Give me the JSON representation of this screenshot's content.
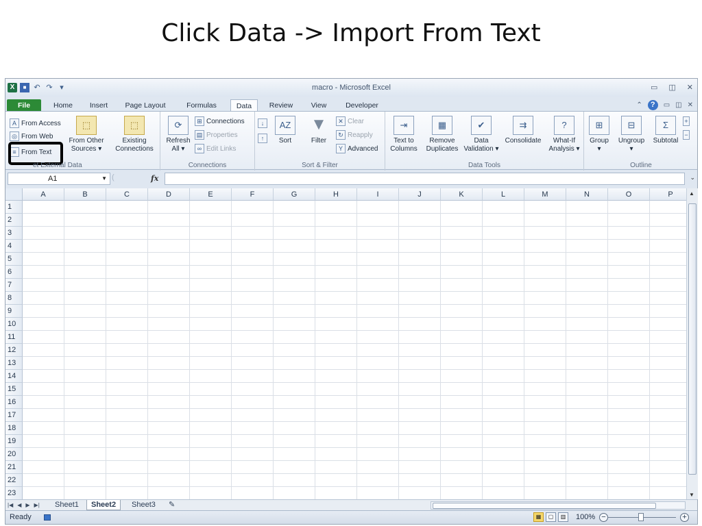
{
  "slide_title": "Click Data -> Import From Text",
  "window": {
    "title": "macro  -  Microsoft Excel",
    "qat_icons": [
      "excel-logo-icon",
      "save-icon",
      "undo-icon",
      "redo-icon",
      "customize-qat-icon"
    ]
  },
  "tabs": {
    "file": "File",
    "home": "Home",
    "insert": "Insert",
    "page_layout": "Page Layout",
    "formulas": "Formulas",
    "data": "Data",
    "review": "Review",
    "view": "View",
    "developer": "Developer"
  },
  "ribbon": {
    "get_external": {
      "from_access": "From Access",
      "from_web": "From Web",
      "from_text": "From Text",
      "from_other_1": "From Other",
      "from_other_2": "Sources ▾",
      "existing_1": "Existing",
      "existing_2": "Connections",
      "label": "Get External Data",
      "label_visible": "et External Data"
    },
    "connections": {
      "refresh_1": "Refresh",
      "refresh_2": "All ▾",
      "connections": "Connections",
      "properties": "Properties",
      "edit_links": "Edit Links",
      "label": "Connections"
    },
    "sort_filter": {
      "sort": "Sort",
      "filter": "Filter",
      "clear": "Clear",
      "reapply": "Reapply",
      "advanced": "Advanced",
      "label": "Sort & Filter"
    },
    "data_tools": {
      "text_to_1": "Text to",
      "text_to_2": "Columns",
      "remove_1": "Remove",
      "remove_2": "Duplicates",
      "validation_1": "Data",
      "validation_2": "Validation ▾",
      "consolidate": "Consolidate",
      "whatif_1": "What-If",
      "whatif_2": "Analysis ▾",
      "label": "Data Tools"
    },
    "outline": {
      "group": "Group",
      "ungroup": "Ungroup",
      "subtotal": "Subtotal",
      "label": "Outline"
    }
  },
  "formula_bar": {
    "name_box": "A1",
    "fx": "fx",
    "value": ""
  },
  "columns": [
    "A",
    "B",
    "C",
    "D",
    "E",
    "F",
    "G",
    "H",
    "I",
    "J",
    "K",
    "L",
    "M",
    "N",
    "O",
    "P"
  ],
  "rows": [
    "1",
    "2",
    "3",
    "4",
    "5",
    "6",
    "7",
    "8",
    "9",
    "10",
    "11",
    "12",
    "13",
    "14",
    "15",
    "16",
    "17",
    "18",
    "19",
    "20",
    "21",
    "22",
    "23"
  ],
  "sheets": [
    "Sheet1",
    "Sheet2",
    "Sheet3"
  ],
  "active_sheet": "Sheet2",
  "status": {
    "ready": "Ready",
    "zoom": "100%"
  },
  "colors": {
    "file_tab": "#2c8a36",
    "highlight_box": "#000000",
    "ribbon_bg": "#fbfcfe"
  }
}
